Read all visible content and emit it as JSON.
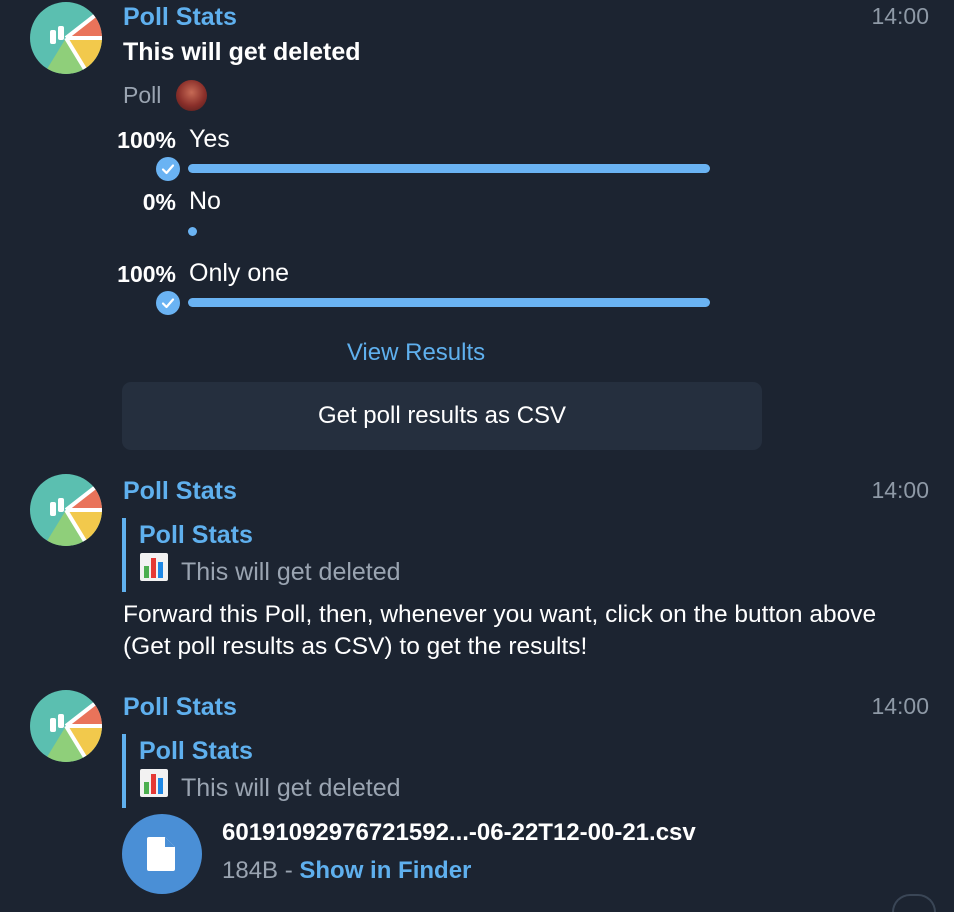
{
  "colors": {
    "background": "#1c2431",
    "accent": "#5fb0ee",
    "bar": "#6ab3f3",
    "muted": "#9aa4b1",
    "button_bg": "#252f3e",
    "file_icon_bg": "#4a8fd6"
  },
  "messages": [
    {
      "sender": "Poll Stats",
      "time": "14:00",
      "avatar_icon": "poll-stats-logo",
      "poll": {
        "question": "This will get deleted",
        "type_label": "Poll",
        "options": [
          {
            "percent": "100%",
            "text": "Yes",
            "fraction": 1.0,
            "chosen": true
          },
          {
            "percent": "0%",
            "text": "No",
            "fraction": 0.0,
            "chosen": false
          },
          {
            "percent": "100%",
            "text": "Only one",
            "fraction": 1.0,
            "chosen": true
          }
        ],
        "view_results": "View Results"
      },
      "inline_button": "Get poll results as CSV"
    },
    {
      "sender": "Poll Stats",
      "time": "14:00",
      "avatar_icon": "poll-stats-logo",
      "reply": {
        "name": "Poll Stats",
        "icon": "bar-chart-icon",
        "text": "This will get deleted"
      },
      "text": "Forward this Poll, then, whenever you want, click on the button above (Get poll results as CSV) to get the results!"
    },
    {
      "sender": "Poll Stats",
      "time": "14:00",
      "avatar_icon": "poll-stats-logo",
      "reply": {
        "name": "Poll Stats",
        "icon": "bar-chart-icon",
        "text": "This will get deleted"
      },
      "file": {
        "icon": "document-icon",
        "name": "60191092976721592...-06-22T12-00-21.csv",
        "size": "184B",
        "separator": " - ",
        "action": "Show in Finder"
      }
    }
  ]
}
